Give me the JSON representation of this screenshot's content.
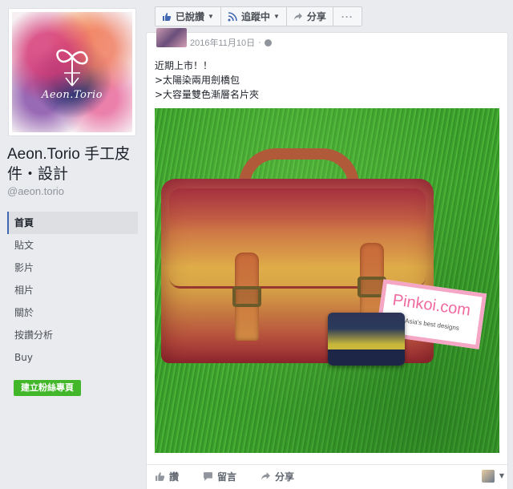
{
  "page": {
    "logo_text": "Aeon.Torio",
    "name": "Aeon.Torio 手工皮件・設計",
    "handle": "@aeon.torio"
  },
  "nav": {
    "items": [
      {
        "label": "首頁",
        "active": true
      },
      {
        "label": "貼文"
      },
      {
        "label": "影片"
      },
      {
        "label": "相片"
      },
      {
        "label": "關於"
      },
      {
        "label": "按讚分析"
      },
      {
        "label": "Buy"
      }
    ],
    "create_label": "建立粉絲專頁"
  },
  "actions": {
    "like_label": "已說讚",
    "follow_label": "追蹤中",
    "share_label": "分享",
    "more_label": "···"
  },
  "post": {
    "date": "2016年11月10日",
    "lines": [
      "近期上市！！",
      ">太陽染兩用劍橋包",
      ">大容量雙色漸層名片夾"
    ],
    "photo_sign_brand": "Pinkoi.com",
    "photo_sign_tag": "you Asia's best designs",
    "like_label": "讚",
    "comment_label": "留言",
    "share_label": "分享"
  },
  "colors": {
    "facebook_blue": "#4267b2",
    "create_green": "#42b72a",
    "background": "#e9ebee"
  }
}
